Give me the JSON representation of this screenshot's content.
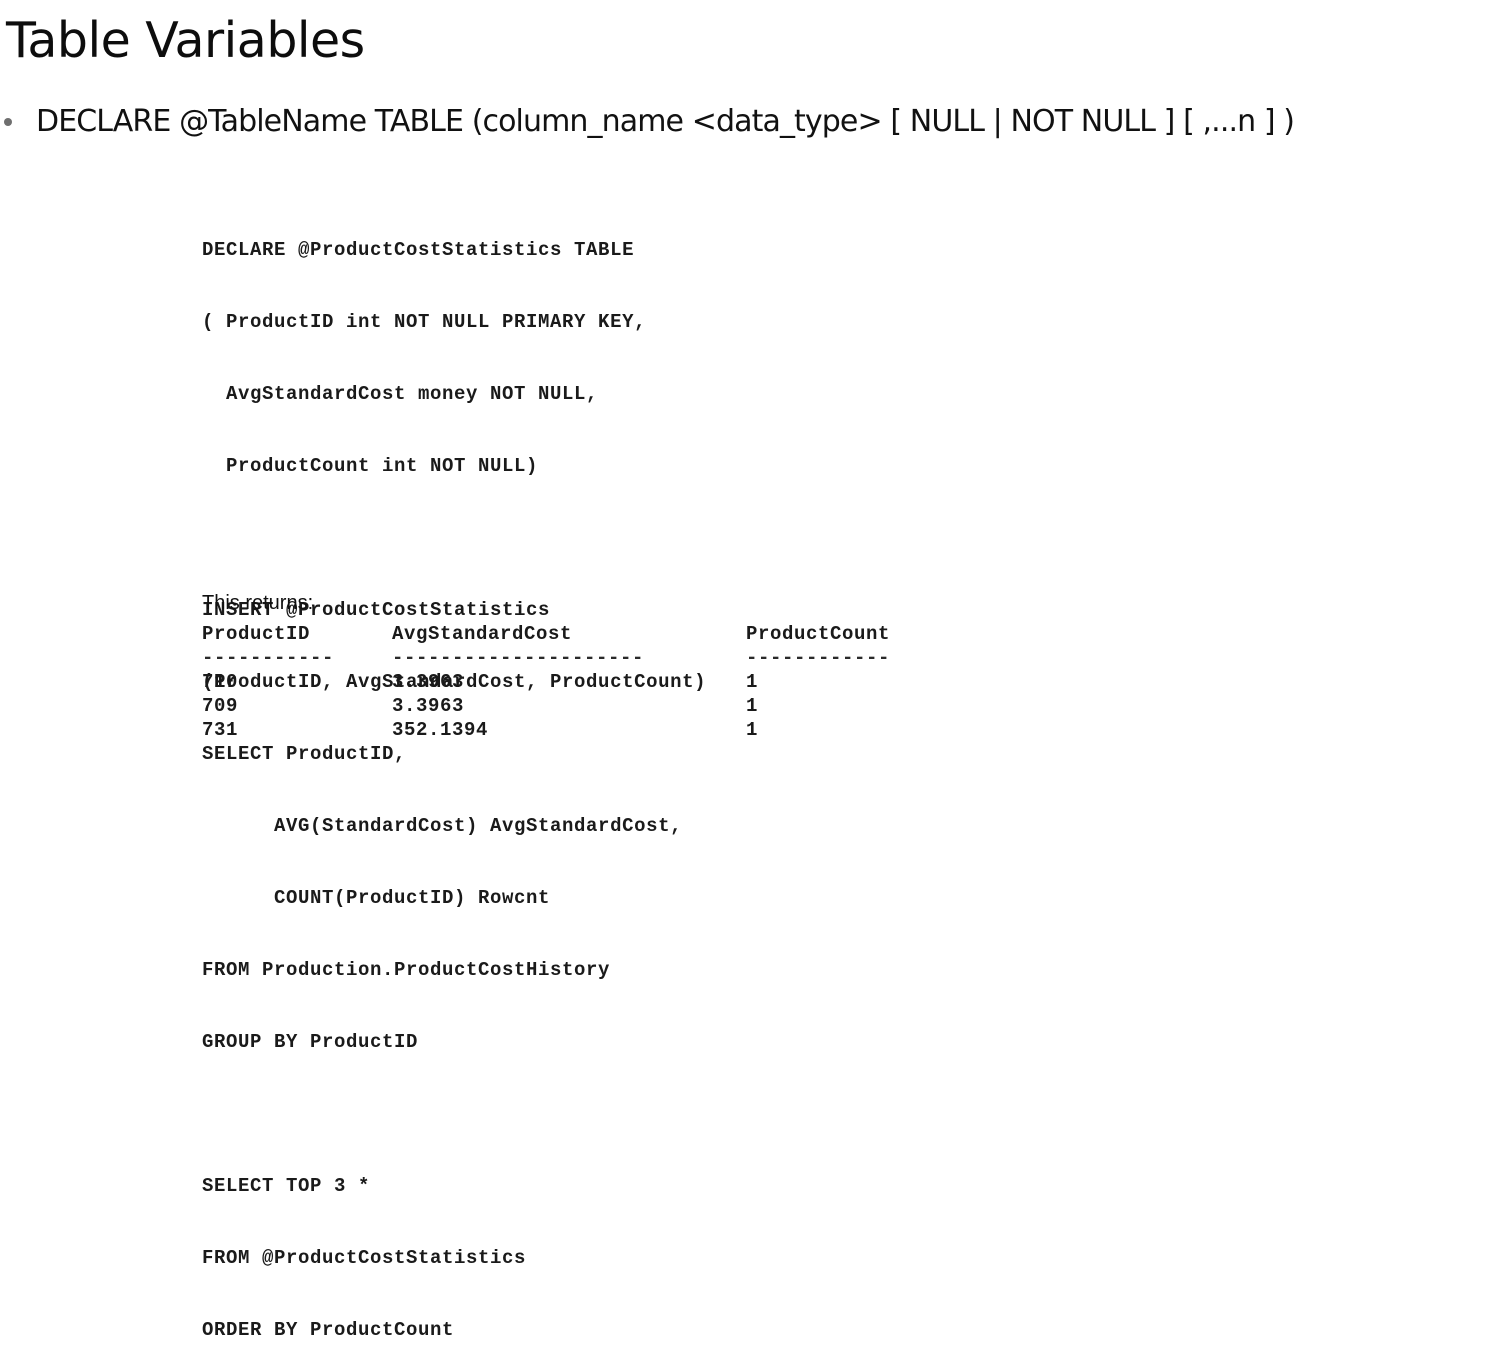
{
  "title": "Table Variables",
  "bullet": {
    "text": "DECLARE @TableName TABLE (column_name <data_type> [ NULL | NOT NULL ] [ ,...n ] )"
  },
  "code": {
    "lines": [
      "DECLARE @ProductCostStatistics TABLE",
      "( ProductID int NOT NULL PRIMARY KEY,",
      "  AvgStandardCost money NOT NULL,",
      "  ProductCount int NOT NULL)",
      "",
      "INSERT @ProductCostStatistics",
      "(ProductID, AvgStandardCost, ProductCount)",
      "SELECT ProductID,",
      "      AVG(StandardCost) AvgStandardCost,",
      "      COUNT(ProductID) Rowcnt",
      "FROM Production.ProductCostHistory",
      "GROUP BY ProductID",
      "",
      "SELECT TOP 3 *",
      "FROM @ProductCostStatistics",
      "ORDER BY ProductCount"
    ]
  },
  "returns_label": "This returns:",
  "result": {
    "headers": [
      "ProductID",
      "AvgStandardCost",
      "ProductCount"
    ],
    "separators": [
      "-----------",
      "---------------------",
      "------------"
    ],
    "rows": [
      [
        "710",
        "3.3963",
        "1"
      ],
      [
        "709",
        "3.3963",
        "1"
      ],
      [
        "731",
        "352.1394",
        "1"
      ]
    ]
  }
}
